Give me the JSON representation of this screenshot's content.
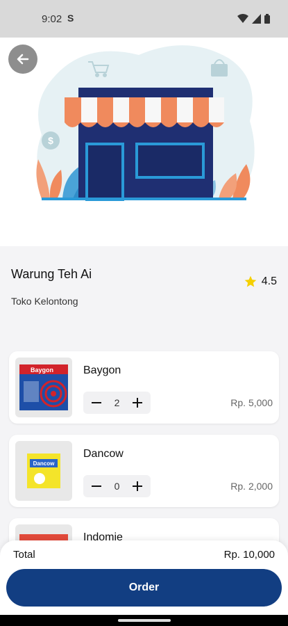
{
  "status": {
    "time": "9:02",
    "sim_label": "S"
  },
  "shop": {
    "name": "Warung Teh Ai",
    "category": "Toko Kelontong",
    "rating": "4.5"
  },
  "products": [
    {
      "name": "Baygon",
      "qty": "2",
      "price": "Rp. 5,000"
    },
    {
      "name": "Dancow",
      "qty": "0",
      "price": "Rp. 2,000"
    },
    {
      "name": "Indomie"
    }
  ],
  "thumb_text": {
    "baygon": "Baygon",
    "dancow": "Dancow"
  },
  "summary": {
    "total_label": "Total",
    "total_value": "Rp. 10,000",
    "order_label": "Order"
  },
  "colors": {
    "primary": "#123e82",
    "star": "#f5d000",
    "awning_orange": "#f08a5d",
    "store_navy": "#1f2f72"
  },
  "icons": [
    "back-arrow-icon",
    "star-icon",
    "minus-icon",
    "plus-icon",
    "wifi-icon",
    "signal-icon",
    "battery-icon",
    "cart-icon",
    "bag-icon",
    "dollar-icon"
  ]
}
